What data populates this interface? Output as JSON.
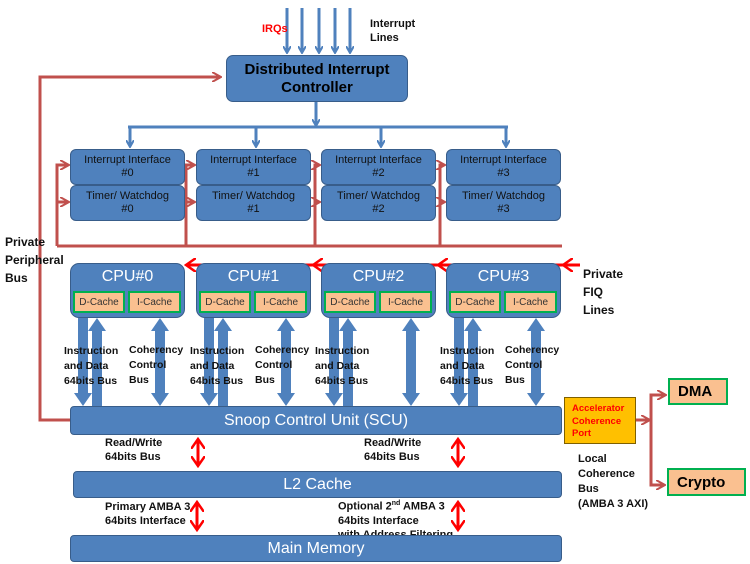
{
  "colors": {
    "block": "#4F81BD",
    "peripheral_bus": "#C0504D",
    "fiq": "#FF0000",
    "cache": "#FAC090",
    "cache_border": "#00B050",
    "acp": "#FFC000"
  },
  "irq_label": "IRQs",
  "interrupt_lines_label": "Interrupt\nLines",
  "distributor": "Distributed Interrupt Controller",
  "interfaces": [
    {
      "interrupt": "Interrupt Interface #0",
      "timer": "Timer/ Watchdog #0"
    },
    {
      "interrupt": "Interrupt Interface #1",
      "timer": "Timer/ Watchdog #1"
    },
    {
      "interrupt": "Interrupt Interface #2",
      "timer": "Timer/ Watchdog #2"
    },
    {
      "interrupt": "Interrupt Interface #3",
      "timer": "Timer/ Watchdog #3"
    }
  ],
  "private_peripheral_bus": "Private\nPeripheral\nBus",
  "private_fiq_lines": "Private\nFIQ\nLines",
  "cpus": [
    {
      "name": "CPU#0",
      "dcache": "D-Cache",
      "icache": "I-Cache",
      "bus1": "Instruction\nand Data\n64bits Bus",
      "bus2": "Coherency\nControl\nBus"
    },
    {
      "name": "CPU#1",
      "dcache": "D-Cache",
      "icache": "I-Cache",
      "bus1": "Instruction\nand Data\n64bits Bus",
      "bus2": "Coherency\nControl\nBus"
    },
    {
      "name": "CPU#2",
      "dcache": "D-Cache",
      "icache": "I-Cache",
      "bus1": "Instruction\nand Data\n64bits Bus",
      "bus2": ""
    },
    {
      "name": "CPU#3",
      "dcache": "D-Cache",
      "icache": "I-Cache",
      "bus1": "Instruction\nand Data\n64bits Bus",
      "bus2": "Coherency\nControl\nBus"
    }
  ],
  "scu": "Snoop Control Unit (SCU)",
  "acp": "Accelerator\nCoherence\nPort",
  "dma": "DMA",
  "crypto": "Crypto",
  "local_bus": "Local\nCoherence\nBus\n(AMBA 3 AXI)",
  "rw_bus_left": "Read/Write\n64bits Bus",
  "rw_bus_right": "Read/Write\n64bits Bus",
  "l2": "L2 Cache",
  "primary_amba": "Primary AMBA 3\n64bits Interface",
  "optional_amba_pre": "Optional 2",
  "optional_amba_sup": "nd",
  "optional_amba_post": " AMBA 3\n64bits Interface\nwith Address Filtering",
  "main_memory": "Main Memory"
}
